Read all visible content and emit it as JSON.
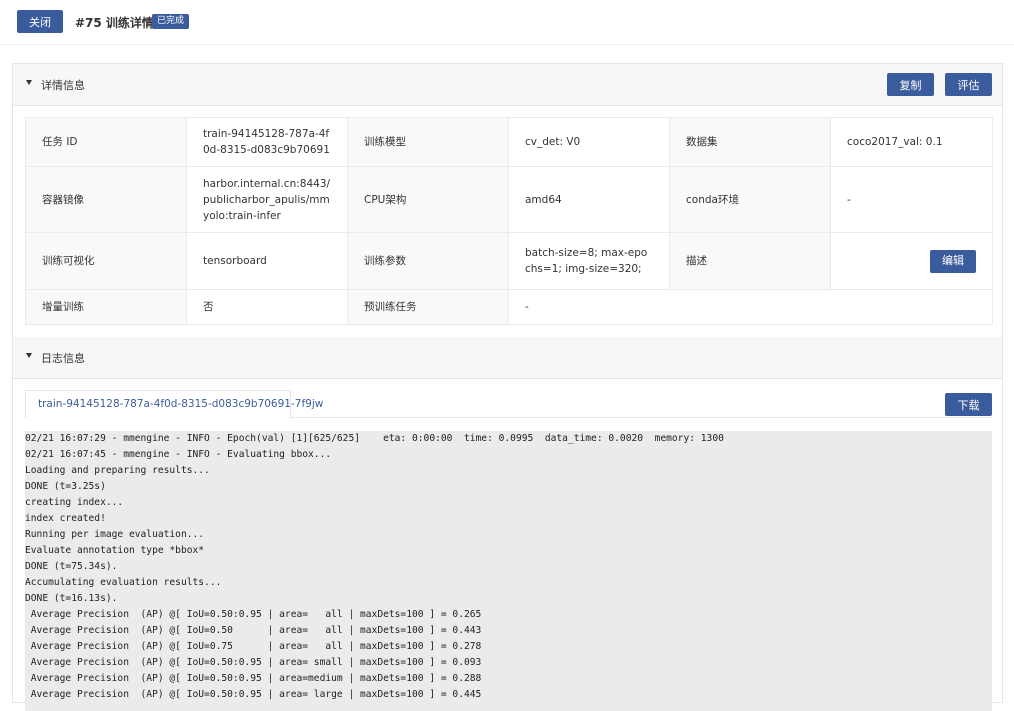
{
  "header": {
    "close_label": "关闭",
    "title": "#75 训练详情",
    "status": "已完成"
  },
  "details": {
    "section_title": "详情信息",
    "copy_label": "复制",
    "evaluate_label": "评估",
    "edit_label": "编辑",
    "rows": [
      [
        {
          "label": "任务 ID",
          "value": "train-94145128-787a-4f0d-8315-d083c9b70691"
        },
        {
          "label": "训练模型",
          "value": "cv_det: V0"
        },
        {
          "label": "数据集",
          "value": "coco2017_val: 0.1"
        }
      ],
      [
        {
          "label": "容器镜像",
          "value": "harbor.internal.cn:8443/publicharbor_apulis/mmyolo:train-infer"
        },
        {
          "label": "CPU架构",
          "value": "amd64"
        },
        {
          "label": "conda环境",
          "value": "-"
        }
      ],
      [
        {
          "label": "训练可视化",
          "value": "tensorboard"
        },
        {
          "label": "训练参数",
          "value": "batch-size=8; max-epochs=1; img-size=320;"
        },
        {
          "label": "描述",
          "value": ""
        }
      ],
      [
        {
          "label": "增量训练",
          "value": "否"
        },
        {
          "label": "预训练任务",
          "value": "-"
        }
      ]
    ]
  },
  "logs": {
    "section_title": "日志信息",
    "tab_label": "train-94145128-787a-4f0d-8315-d083c9b70691-7f9jw",
    "download_label": "下载",
    "lines": [
      "02/21 16:07:29 - mmengine - INFO - Epoch(val) [1][625/625]    eta: 0:00:00  time: 0.0995  data_time: 0.0020  memory: 1300",
      "02/21 16:07:45 - mmengine - INFO - Evaluating bbox...",
      "Loading and preparing results...",
      "DONE (t=3.25s)",
      "creating index...",
      "index created!",
      "Running per image evaluation...",
      "Evaluate annotation type *bbox*",
      "DONE (t=75.34s).",
      "Accumulating evaluation results...",
      "DONE (t=16.13s).",
      " Average Precision  (AP) @[ IoU=0.50:0.95 | area=   all | maxDets=100 ] = 0.265",
      " Average Precision  (AP) @[ IoU=0.50      | area=   all | maxDets=100 ] = 0.443",
      " Average Precision  (AP) @[ IoU=0.75      | area=   all | maxDets=100 ] = 0.278",
      " Average Precision  (AP) @[ IoU=0.50:0.95 | area= small | maxDets=100 ] = 0.093",
      " Average Precision  (AP) @[ IoU=0.50:0.95 | area=medium | maxDets=100 ] = 0.288",
      " Average Precision  (AP) @[ IoU=0.50:0.95 | area= large | maxDets=100 ] = 0.445"
    ]
  },
  "colors": {
    "primary": "#3b5c9c",
    "header_bg": "#f7f7f7",
    "log_bg": "#ebebeb"
  }
}
